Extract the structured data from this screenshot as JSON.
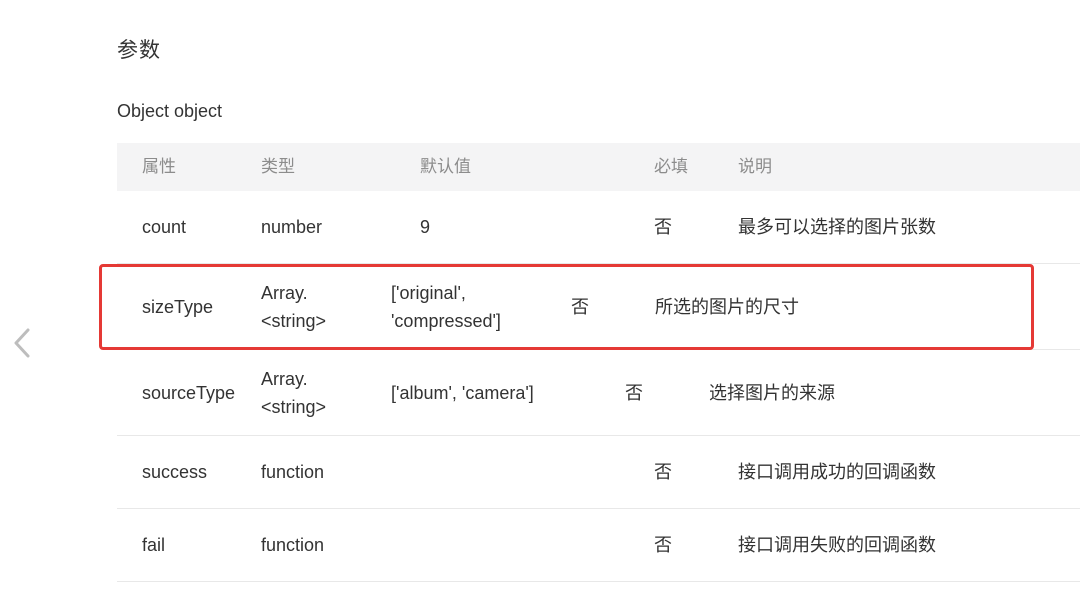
{
  "section_title": "参数",
  "object_label": "Object object",
  "table": {
    "headers": [
      "属性",
      "类型",
      "默认值",
      "必填",
      "说明"
    ],
    "rows": [
      {
        "name": "count",
        "type": "number",
        "default": "9",
        "required": "否",
        "desc": "最多可以选择的图片张数"
      },
      {
        "name": "sizeType",
        "type": "Array.<string>",
        "default": "['original', 'compressed']",
        "required": "否",
        "desc": "所选的图片的尺寸"
      },
      {
        "name": "sourceType",
        "type": "Array.<string>",
        "default": "['album', 'camera']",
        "required": "否",
        "desc": "选择图片的来源"
      },
      {
        "name": "success",
        "type": "function",
        "default": "",
        "required": "否",
        "desc": "接口调用成功的回调函数"
      },
      {
        "name": "fail",
        "type": "function",
        "default": "",
        "required": "否",
        "desc": "接口调用失败的回调函数"
      }
    ]
  },
  "highlight_color": "#e53935",
  "back_icon": "chevron-left-icon"
}
